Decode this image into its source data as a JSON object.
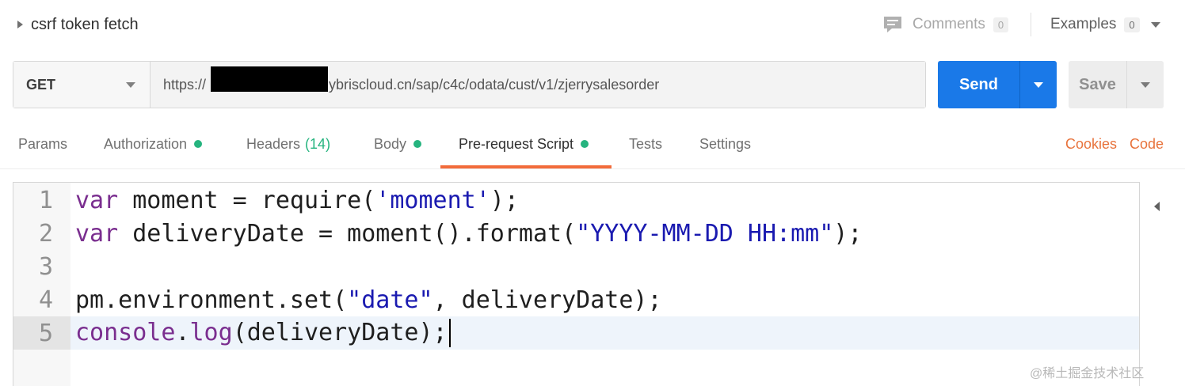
{
  "header": {
    "request_name": "csrf token fetch",
    "comments_label": "Comments",
    "comments_count": "0",
    "examples_label": "Examples",
    "examples_count": "0"
  },
  "request": {
    "method": "GET",
    "url_prefix": "https://",
    "url_suffix": "hybriscloud.cn/sap/c4c/odata/cust/v1/zjerrysalesorder",
    "send_label": "Send",
    "save_label": "Save"
  },
  "tabs": [
    {
      "label": "Params"
    },
    {
      "label": "Authorization",
      "dot": true
    },
    {
      "label": "Headers",
      "count": "(14)"
    },
    {
      "label": "Body",
      "dot": true
    },
    {
      "label": "Pre-request Script",
      "dot": true,
      "active": true
    },
    {
      "label": "Tests"
    },
    {
      "label": "Settings"
    }
  ],
  "links": {
    "cookies": "Cookies",
    "code": "Code"
  },
  "editor": {
    "line_numbers": [
      "1",
      "2",
      "3",
      "4",
      "5"
    ],
    "lines": [
      "var moment = require('moment');",
      "var deliveryDate = moment().format(\"YYYY-MM-DD HH:mm\");",
      "",
      "pm.environment.set(\"date\", deliveryDate);",
      "console.log(deliveryDate);"
    ],
    "active_line": 5
  },
  "watermark": "@稀土掘金技术社区",
  "colors": {
    "send_blue": "#1a79e8",
    "active_tab_underline": "#f26b3a",
    "status_dot_green": "#26b47f",
    "link_orange": "#e8733c",
    "keyword_purple": "#7a2e8f",
    "string_blue": "#1a1ab0"
  },
  "icons": {
    "comments": "comment-bubble-icon",
    "collapse": "caret-right-icon",
    "dropdown": "chevron-down-icon"
  }
}
